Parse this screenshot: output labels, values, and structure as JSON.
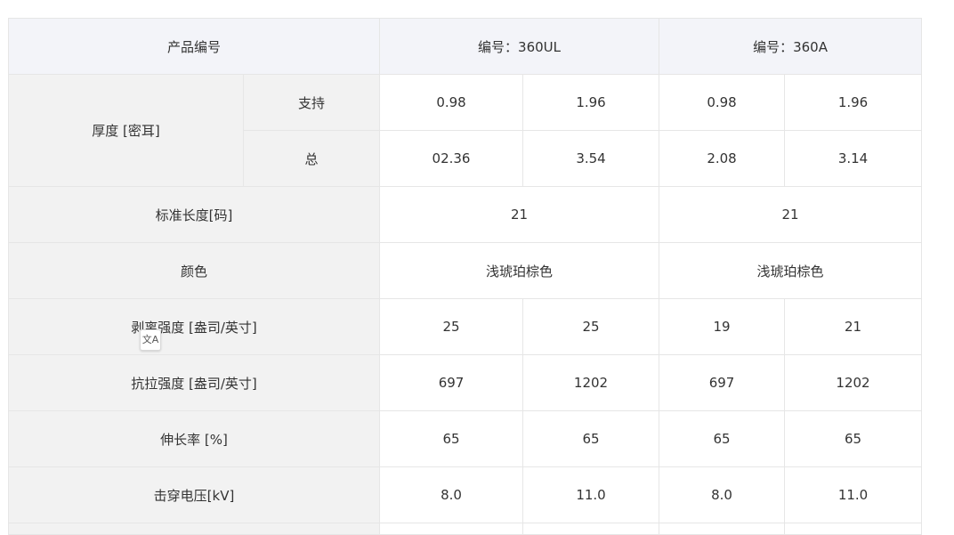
{
  "header": {
    "product_label": "产品编号",
    "col1": "编号：360UL",
    "col2": "编号：360A"
  },
  "thickness": {
    "label": "厚度 [密耳]",
    "support_label": "支持",
    "support_values": [
      "0.98",
      "1.96",
      "0.98",
      "1.96"
    ],
    "total_label": "总",
    "total_values": [
      "02.36",
      "3.54",
      "2.08",
      "3.14"
    ]
  },
  "length": {
    "label": "标准长度[码]",
    "values": [
      "21",
      "21"
    ]
  },
  "color": {
    "label": "颜色",
    "values": [
      "浅琥珀棕色",
      "浅琥珀棕色"
    ]
  },
  "peel": {
    "label": "剥离强度 [盎司/英寸]",
    "values": [
      "25",
      "25",
      "19",
      "21"
    ]
  },
  "tensile": {
    "label": "抗拉强度 [盎司/英寸]",
    "values": [
      "697",
      "1202",
      "697",
      "1202"
    ]
  },
  "elongation": {
    "label": "伸长率 [%]",
    "values": [
      "65",
      "65",
      "65",
      "65"
    ]
  },
  "breakdown": {
    "label": "击穿电压[kV]",
    "values": [
      "8.0",
      "11.0",
      "8.0",
      "11.0"
    ]
  },
  "translate_icon": {
    "glyph": "文A"
  }
}
